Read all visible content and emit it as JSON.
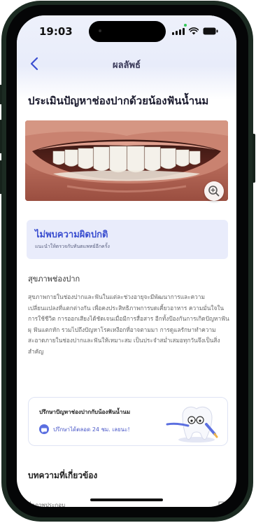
{
  "status_bar": {
    "time": "19:03"
  },
  "nav": {
    "title": "ผลลัพธ์"
  },
  "headline": "ประเมินปัญหาช่องปากด้วยน้องฟันน้ำนม",
  "result": {
    "title": "ไม่พบความผิดปกติ",
    "subtitle": "แนะนำให้ตรวจกับทันตแพทย์อีกครั้ง"
  },
  "oral_health": {
    "title": "สุขภาพช่องปาก",
    "body": "สุขภาพกายในช่องปากและฟันในแต่ละช่วงอายุจะมีพัฒนาการและความเปลี่ยนแปลงที่แตกต่างกัน เพื่อคงประสิทธิภาพการบดเคี้ยวอาหาร ความมั่นใจในการใช้ชีวิต การออกเสียงได้ชัดเจนเมื่อมีการสื่อสาร อีกทั้งป้องกันการเกิดปัญหาฟันผุ ฟันแตกหัก รวมไปถึงปัญหาโรคเหงือกที่อาจตามมา การดูแลรักษาทำความสะอาดภายในช่องปากและฟันให้เหมาะสม เป็นประจำสม่ำเสมอทุกวันจึงเป็นสิ่งสำคัญ"
  },
  "consult": {
    "title": "ปรึกษาปัญหาช่องปากกับน้องฟันน้ำนม",
    "action": "ปรึกษาได้ตลอด 24 ชม. เลยนะ!"
  },
  "related": {
    "title": "บทความที่เกี่ยวข้อง",
    "first_item": "สื่อภาพประกอบ"
  },
  "colors": {
    "accent": "#3b4fd0",
    "card_bg": "#e9ecfb",
    "frame": "#1c2b22"
  },
  "icons": {
    "back": "chevron-left-icon",
    "zoom": "zoom-in-icon",
    "chat": "chat-bubble-icon",
    "bookmark": "bookmark-icon"
  }
}
